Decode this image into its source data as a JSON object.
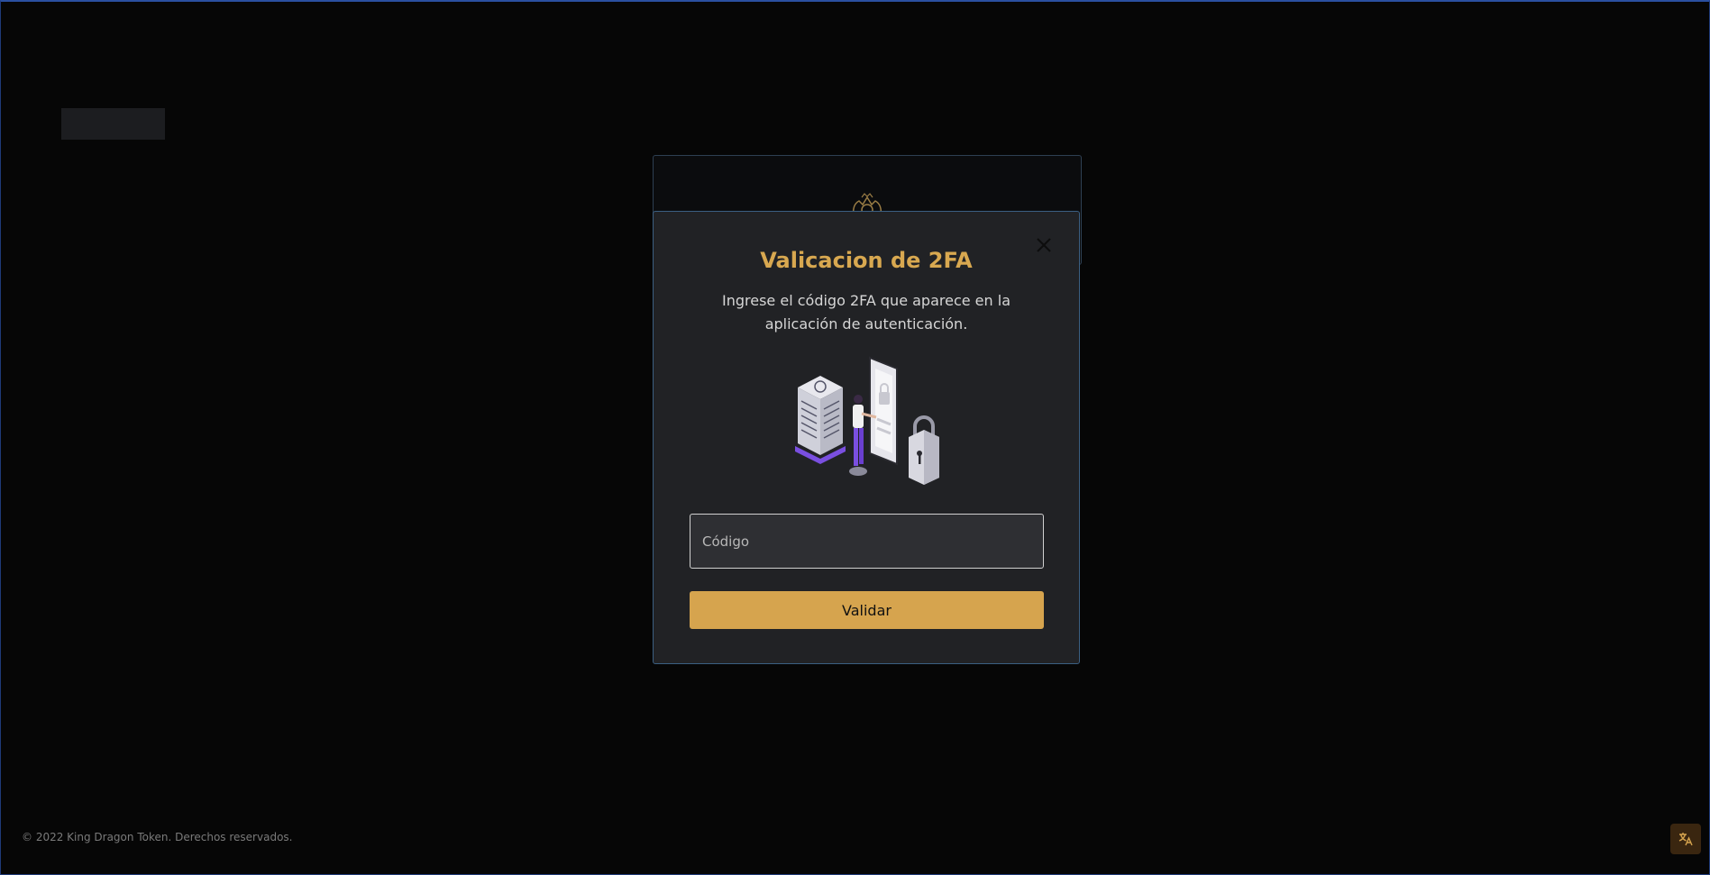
{
  "modal": {
    "title": "Valicacion de 2FA",
    "description": "Ingrese el código 2FA que aparece en la aplicación de autenticación.",
    "code_placeholder": "Código",
    "code_value": "",
    "validate_label": "Validar"
  },
  "footer": {
    "copyright": "© 2022 King Dragon Token. Derechos reservados."
  },
  "icons": {
    "close": "close-icon",
    "language": "translate-icon",
    "crest": "crest-logo-icon"
  },
  "colors": {
    "accent": "#d6a44e",
    "title": "#d8a850",
    "modal_bg": "#212225",
    "page_bg": "#060606",
    "lang_btn_bg": "#3a2610"
  }
}
